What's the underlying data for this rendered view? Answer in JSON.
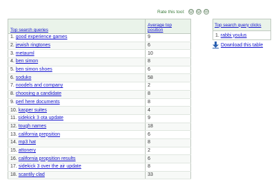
{
  "rate_tool": {
    "label": "Rate this tool:",
    "faces": [
      {
        "icon": "happy-face-icon",
        "glyph": "☺"
      },
      {
        "icon": "neutral-face-icon",
        "glyph": "☺"
      },
      {
        "icon": "sad-face-icon",
        "glyph": "☹"
      }
    ]
  },
  "queries_table": {
    "col_query": "Top search queries",
    "col_position": "Average top position",
    "rows": [
      {
        "num": "1.",
        "query": "good experience games",
        "position": "9"
      },
      {
        "num": "2.",
        "query": "jewish ringtones",
        "position": "6"
      },
      {
        "num": "3.",
        "query": "metauml",
        "position": "10"
      },
      {
        "num": "4.",
        "query": "ben simon",
        "position": "8"
      },
      {
        "num": "5.",
        "query": "ben simon shoes",
        "position": "6"
      },
      {
        "num": "6.",
        "query": "soduko",
        "position": "58"
      },
      {
        "num": "7.",
        "query": "noodels and company",
        "position": "2"
      },
      {
        "num": "8.",
        "query": "choosing a candidate",
        "position": "8"
      },
      {
        "num": "9.",
        "query": "perl here documents",
        "position": "8"
      },
      {
        "num": "10.",
        "query": "kasper suites",
        "position": "4"
      },
      {
        "num": "11.",
        "query": "sidekick 3 ota update",
        "position": "9"
      },
      {
        "num": "12.",
        "query": "tough names",
        "position": "18"
      },
      {
        "num": "13.",
        "query": "california prepsition",
        "position": "6"
      },
      {
        "num": "14.",
        "query": "mp3 hat",
        "position": "8"
      },
      {
        "num": "15.",
        "query": "attonery",
        "position": "2"
      },
      {
        "num": "16.",
        "query": "california propsition results",
        "position": "6"
      },
      {
        "num": "17.",
        "query": "sidekick 3 over the air update",
        "position": "8"
      },
      {
        "num": "18.",
        "query": "scantily clad",
        "position": "33"
      }
    ]
  },
  "clicks_table": {
    "header": "Top search query clicks",
    "rows": [
      {
        "num": "1.",
        "query": "rabbi youlus"
      }
    ]
  },
  "download": {
    "label": "Download this table",
    "icon": "download-arrow-icon"
  }
}
